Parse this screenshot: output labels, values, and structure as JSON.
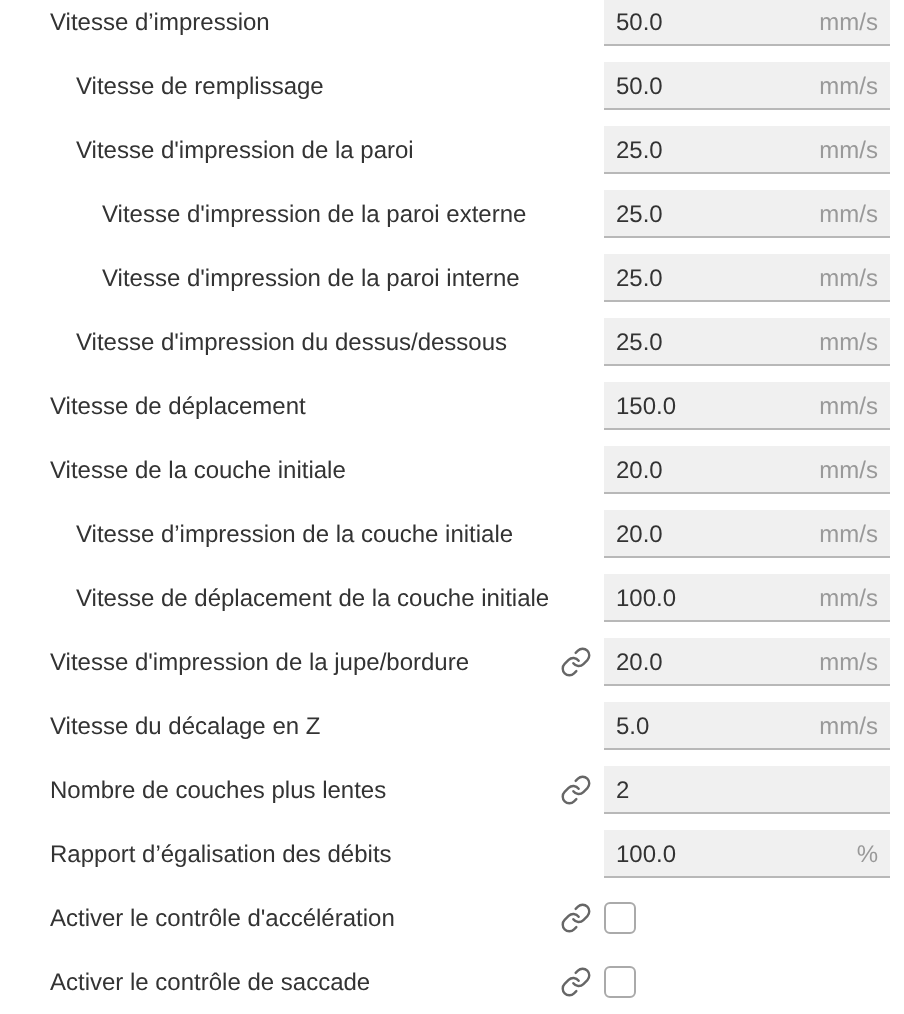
{
  "settings": [
    {
      "label": "Vitesse d’impression",
      "kind": "number",
      "value": "50.0",
      "unit": "mm/s",
      "linked": false,
      "children": [
        {
          "label": "Vitesse de remplissage",
          "kind": "number",
          "value": "50.0",
          "unit": "mm/s",
          "linked": false
        },
        {
          "label": "Vitesse d'impression de la paroi",
          "kind": "number",
          "value": "25.0",
          "unit": "mm/s",
          "linked": false,
          "children": [
            {
              "label": "Vitesse d'impression de la paroi externe",
              "kind": "number",
              "value": "25.0",
              "unit": "mm/s",
              "linked": false
            },
            {
              "label": "Vitesse d'impression de la paroi interne",
              "kind": "number",
              "value": "25.0",
              "unit": "mm/s",
              "linked": false
            }
          ]
        },
        {
          "label": "Vitesse d'impression du dessus/dessous",
          "kind": "number",
          "value": "25.0",
          "unit": "mm/s",
          "linked": false
        }
      ]
    },
    {
      "label": "Vitesse de déplacement",
      "kind": "number",
      "value": "150.0",
      "unit": "mm/s",
      "linked": false
    },
    {
      "label": "Vitesse de la couche initiale",
      "kind": "number",
      "value": "20.0",
      "unit": "mm/s",
      "linked": false,
      "children": [
        {
          "label": "Vitesse d’impression de la couche initiale",
          "kind": "number",
          "value": "20.0",
          "unit": "mm/s",
          "linked": false
        },
        {
          "label": "Vitesse de déplacement de la couche initiale",
          "kind": "number",
          "value": "100.0",
          "unit": "mm/s",
          "linked": false
        }
      ]
    },
    {
      "label": "Vitesse d'impression de la jupe/bordure",
      "kind": "number",
      "value": "20.0",
      "unit": "mm/s",
      "linked": true
    },
    {
      "label": "Vitesse du décalage en Z",
      "kind": "number",
      "value": "5.0",
      "unit": "mm/s",
      "linked": false
    },
    {
      "label": "Nombre de couches plus lentes",
      "kind": "number",
      "value": "2",
      "linked": true
    },
    {
      "label": "Rapport d’égalisation des débits",
      "kind": "number",
      "value": "100.0",
      "unit": "%",
      "linked": false
    },
    {
      "label": "Activer le contrôle d'accélération",
      "kind": "checkbox",
      "checked": false,
      "linked": true
    },
    {
      "label": "Activer le contrôle de saccade",
      "kind": "checkbox",
      "checked": false,
      "linked": true
    }
  ]
}
